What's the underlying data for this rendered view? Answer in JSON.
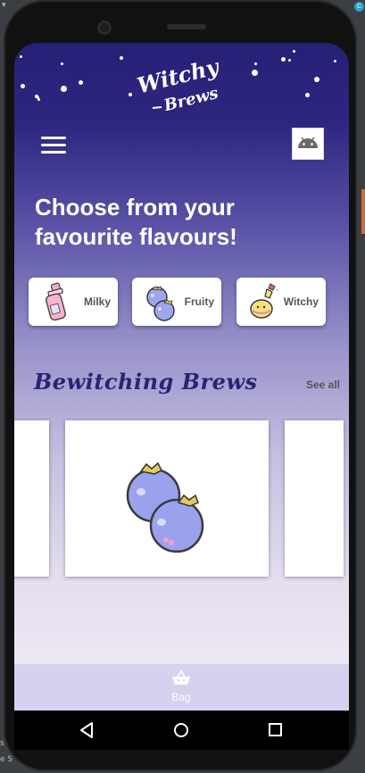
{
  "app": {
    "logo_line1": "Witchy",
    "logo_line2": "Brews",
    "headline": "Choose from your favourite flavours!",
    "categories": [
      {
        "label": "Milky",
        "icon": "milk-bottle-icon"
      },
      {
        "label": "Fruity",
        "icon": "blueberries-icon"
      },
      {
        "label": "Witchy",
        "icon": "potion-icon"
      }
    ],
    "section": {
      "title": "Bewitching Brews",
      "see_all": "See all"
    },
    "products": [
      {
        "icon": "blueberries-icon"
      }
    ],
    "bottom_bar": {
      "bag_label": "Bag",
      "icon": "shopping-basket-icon"
    }
  },
  "colors": {
    "header_top": "#262075",
    "accent_title": "#2a2375",
    "bottom_bar": "#d5d1ef"
  }
}
